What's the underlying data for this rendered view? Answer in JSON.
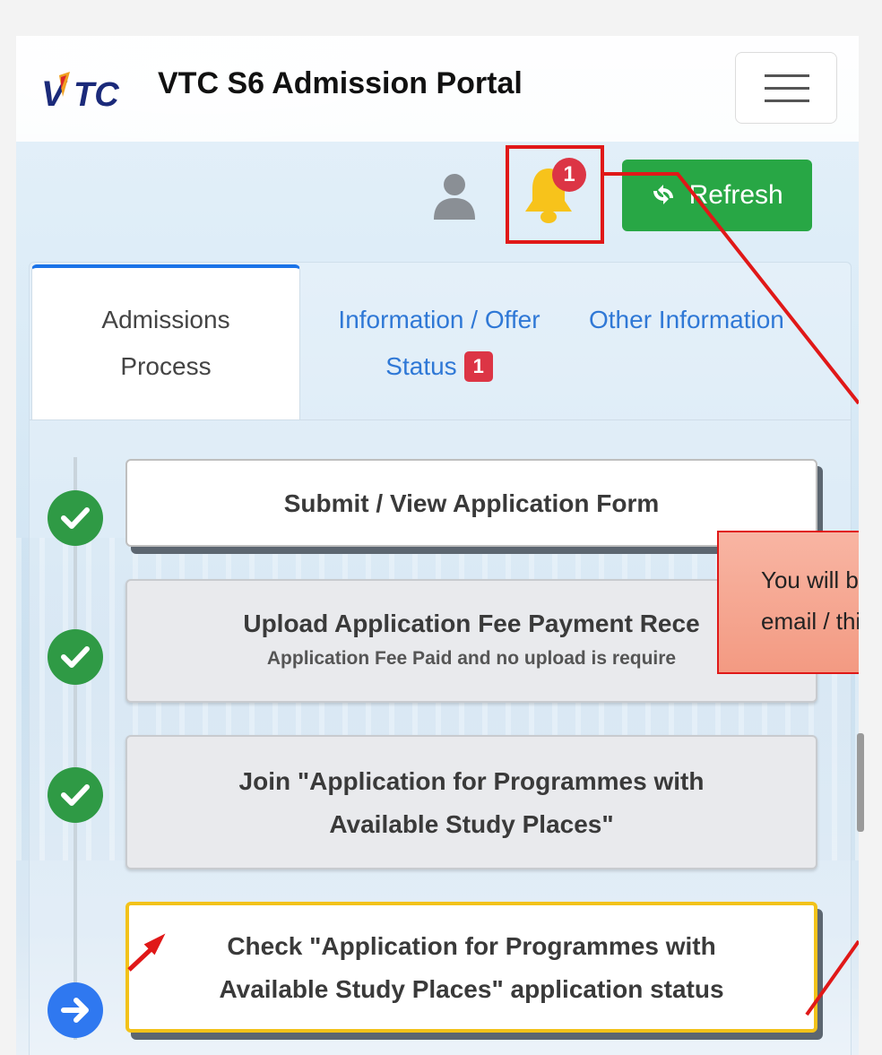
{
  "app": {
    "title": "VTC S6 Admission Portal",
    "logo_text": "VTC"
  },
  "header": {
    "notification_count": "1",
    "refresh_label": "Refresh"
  },
  "tabs": [
    {
      "label_line1": "Admissions",
      "label_line2": "Process",
      "active": true
    },
    {
      "label_line1": "Information / Offer",
      "label_line2": "Status",
      "badge": "1"
    },
    {
      "label_line1": "Other Information"
    }
  ],
  "steps": [
    {
      "title": "Submit / View Application Form",
      "status": "completed"
    },
    {
      "title": "Upload Application Fee Payment Rece",
      "subtitle": "Application Fee Paid and no upload is require",
      "status": "completed"
    },
    {
      "title_line1": "Join \"Application for Programmes with",
      "title_line2": "Available Study Places\"",
      "status": "completed"
    },
    {
      "title_line1": "Check \"Application for Programmes with",
      "title_line2": "Available Study Places\" application status",
      "status": "current"
    }
  ],
  "tooltip": {
    "line1": "You will b",
    "line2": "email / thi"
  },
  "colors": {
    "refresh_green": "#28a745",
    "badge_red": "#dc3545",
    "link_blue": "#2f78d6",
    "check_green": "#2f9a45",
    "current_blue": "#2f78f0",
    "highlight_yellow": "#f2c21a",
    "annotation_red": "#e01818"
  },
  "icons": [
    "vtc-logo",
    "hamburger-icon",
    "user-icon",
    "bell-icon",
    "refresh-icon",
    "check-icon",
    "arrow-right-icon"
  ]
}
